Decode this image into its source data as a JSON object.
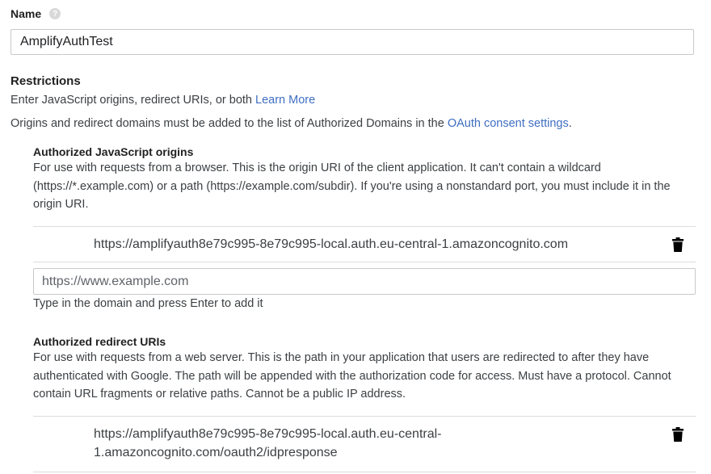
{
  "name_field": {
    "label": "Name",
    "help_icon": "?",
    "value": "AmplifyAuthTest"
  },
  "restrictions": {
    "title": "Restrictions",
    "intro_text": "Enter JavaScript origins, redirect URIs, or both",
    "learn_more": "Learn More",
    "domains_text": "Origins and redirect domains must be added to the list of Authorized Domains in the",
    "consent_link": "OAuth consent settings",
    "domains_suffix": "."
  },
  "js_origins": {
    "title": "Authorized JavaScript origins",
    "description": "For use with requests from a browser. This is the origin URI of the client application. It can't contain a wildcard (https://*.example.com) or a path (https://example.com/subdir). If you're using a nonstandard port, you must include it in the origin URI.",
    "entries": [
      "https://amplifyauth8e79c995-8e79c995-local.auth.eu-central-1.amazoncognito.com"
    ],
    "input_placeholder": "https://www.example.com",
    "hint": "Type in the domain and press Enter to add it"
  },
  "redirect_uris": {
    "title": "Authorized redirect URIs",
    "description": "For use with requests from a web server. This is the path in your application that users are redirected to after they have authenticated with Google. The path will be appended with the authorization code for access. Must have a protocol. Cannot contain URL fragments or relative paths. Cannot be a public IP address.",
    "entries": [
      "https://amplifyauth8e79c995-8e79c995-local.auth.eu-central-1.amazoncognito.com/oauth2/idpresponse"
    ],
    "entry_line1": "https://amplifyauth8e79c995-8e79c995-local.auth.eu-central-",
    "entry_line2": "1.amazoncognito.com/oauth2/idpresponse"
  },
  "icons": {
    "help": "help-circle-icon",
    "delete": "trash-icon"
  },
  "colors": {
    "link": "#3f6ec2",
    "text": "#3c4043",
    "heading": "#212121",
    "divider": "#dadce0",
    "help_icon_bg": "#d9d9d9"
  }
}
